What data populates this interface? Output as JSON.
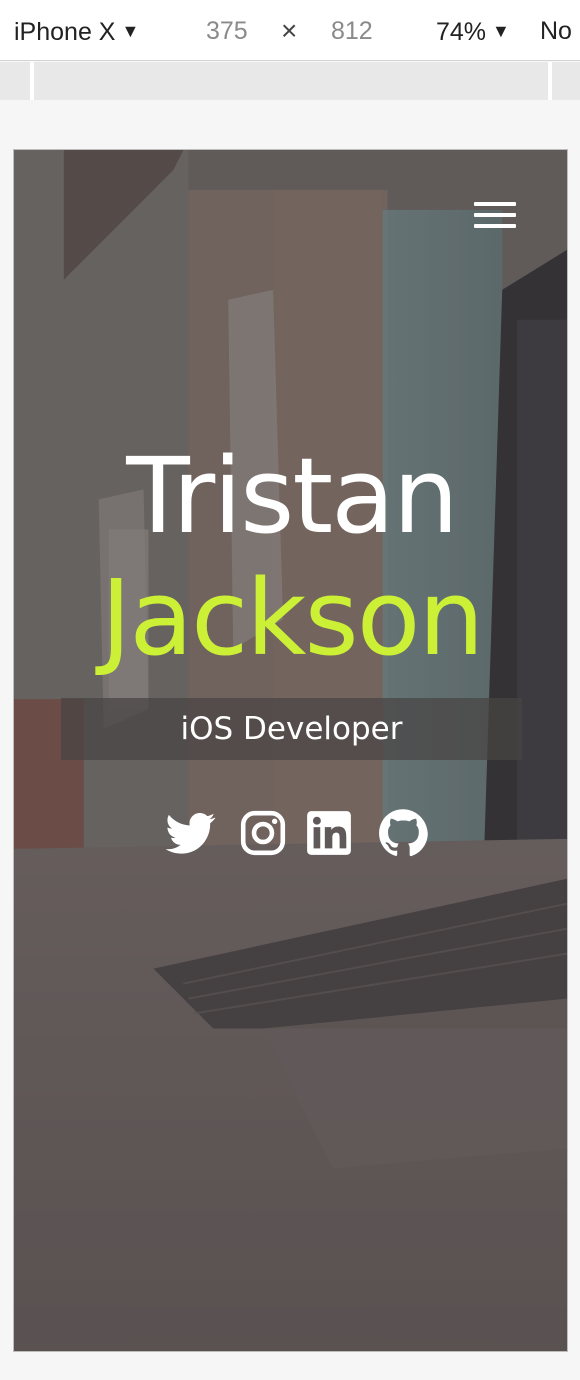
{
  "devtools": {
    "device_name": "iPhone X",
    "width_value": "375",
    "times_symbol": "×",
    "height_value": "812",
    "zoom": "74%",
    "throttle": "No"
  },
  "hero": {
    "first_name": "Tristan",
    "last_name": "Jackson",
    "role": "iOS Developer",
    "accent_color": "#ccf036",
    "menu_icon": "hamburger-menu-icon"
  },
  "social_links": [
    {
      "icon": "twitter-icon"
    },
    {
      "icon": "instagram-icon"
    },
    {
      "icon": "linkedin-icon"
    },
    {
      "icon": "github-icon"
    }
  ]
}
